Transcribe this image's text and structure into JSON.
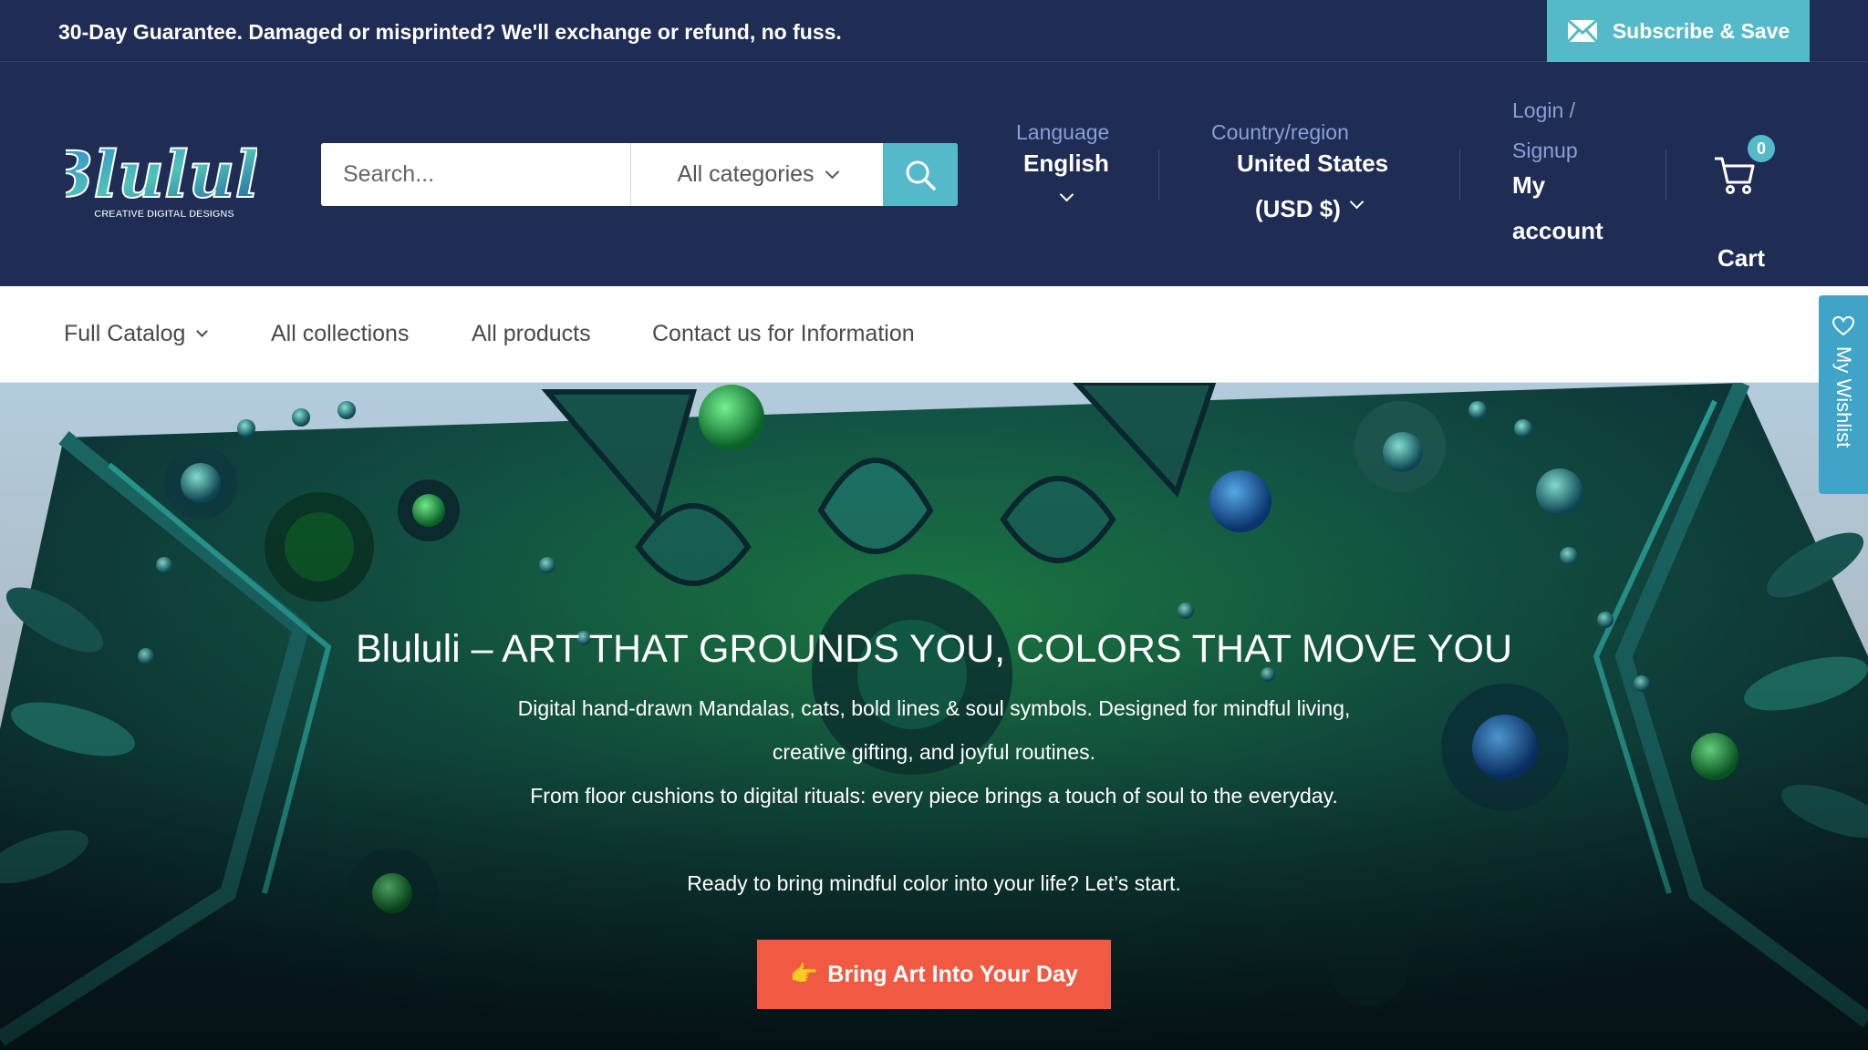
{
  "announcement": {
    "text": "30-Day Guarantee. Damaged or misprinted? We'll exchange or refund, no fuss.",
    "subscribe_label": "Subscribe & Save",
    "subscribe_icon": "mail-icon"
  },
  "header": {
    "logo_text": "Blululi",
    "logo_tagline": "CREATIVE DIGITAL DESIGNS",
    "search": {
      "placeholder": "Search...",
      "category_selected": "All categories"
    },
    "language": {
      "label": "Language",
      "value": "English"
    },
    "country": {
      "label": "Country/region",
      "value": "United States",
      "currency": "(USD $)"
    },
    "account": {
      "login_line1": "Login /",
      "login_line2": "Signup",
      "account_line1": "My",
      "account_line2": "account"
    },
    "cart": {
      "count": "0",
      "label": "Cart"
    }
  },
  "nav": {
    "items": [
      {
        "label": "Full Catalog"
      },
      {
        "label": "All collections"
      },
      {
        "label": "All products"
      },
      {
        "label": "Contact us for Information"
      }
    ]
  },
  "hero": {
    "title": "Blululi – ART THAT GROUNDS YOU, COLORS THAT MOVE YOU",
    "line1": "Digital hand-drawn Mandalas, cats, bold lines & soul symbols. Designed for mindful living,",
    "line2": "creative gifting, and joyful routines.",
    "line3": "From floor cushions to digital rituals: every piece brings a touch of soul to the everyday.",
    "line4": "Ready to bring mindful color into your life? Let’s start.",
    "cta_icon": "👉",
    "cta_label": "Bring Art Into Your Day"
  },
  "wishlist": {
    "label": "My Wishlist"
  },
  "colors": {
    "header_bg": "#1f2d55",
    "accent": "#54b9c9",
    "cta": "#f05a43",
    "wishlist_tab": "#3fa4c7"
  }
}
